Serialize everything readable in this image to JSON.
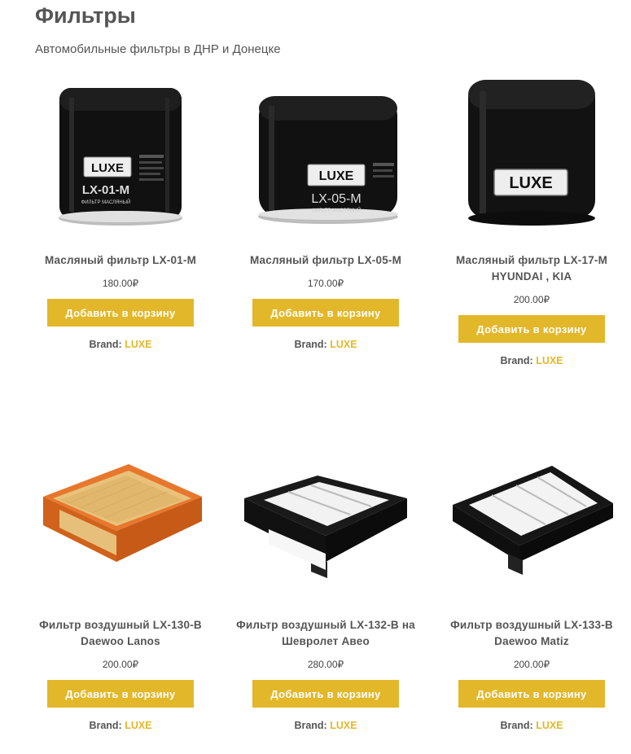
{
  "page": {
    "title": "Фильтры",
    "subtitle": "Автомобильные фильтры в ДНР и Донецке"
  },
  "theme": {
    "accent": "#e3b72a",
    "text": "#555555"
  },
  "products": [
    {
      "name": "Масляный фильтр LX-01-M",
      "price": "180.00₽",
      "button": "Добавить в корзину",
      "brand_label": "Brand:",
      "brand": "LUXE",
      "image": "oil-filter-icon",
      "label_text": "LX-01-M"
    },
    {
      "name": "Масляный фильтр LX-05-M",
      "price": "170.00₽",
      "button": "Добавить в корзину",
      "brand_label": "Brand:",
      "brand": "LUXE",
      "image": "oil-filter-icon",
      "label_text": "LX-05-M"
    },
    {
      "name": "Масляный фильтр LX-17-M HYUNDAI , KIA",
      "price": "200.00₽",
      "button": "Добавить в корзину",
      "brand_label": "Brand:",
      "brand": "LUXE",
      "image": "oil-filter-icon"
    },
    {
      "name": "Фильтр воздушный LX-130-B Daewoo Lanos",
      "price": "200.00₽",
      "button": "Добавить в корзину",
      "brand_label": "Brand:",
      "brand": "LUXE",
      "image": "air-filter-orange-icon"
    },
    {
      "name": "Фильтр воздушный LX-132-B на Шевролет Авео",
      "price": "280.00₽",
      "button": "Добавить в корзину",
      "brand_label": "Brand:",
      "brand": "LUXE",
      "image": "air-filter-black-icon"
    },
    {
      "name": "Фильтр воздушный LX-133-B Daewoo Matiz",
      "price": "200.00₽",
      "button": "Добавить в корзину",
      "brand_label": "Brand:",
      "brand": "LUXE",
      "image": "air-filter-black-icon"
    }
  ],
  "logo_text": "LUXE",
  "oil_label": "ФИЛЬТР МАСЛЯНЫЙ"
}
